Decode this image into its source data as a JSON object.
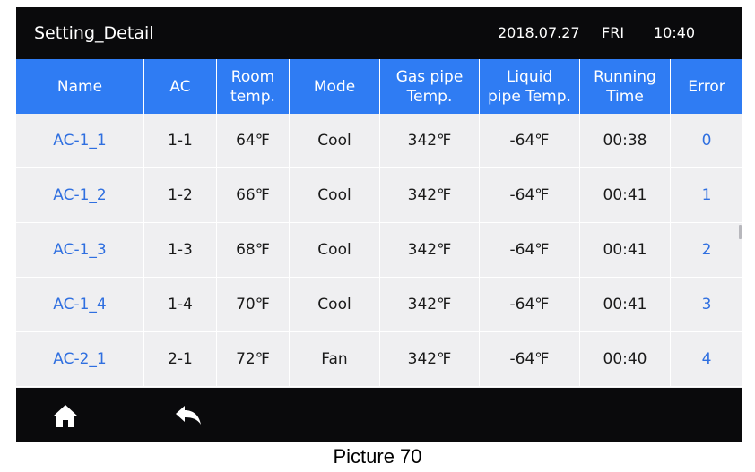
{
  "titlebar": {
    "title": "Setting_Detail",
    "date": "2018.07.27",
    "weekday": "FRI",
    "time": "10:40"
  },
  "table": {
    "headers": [
      "Name",
      "AC",
      "Room\ntemp.",
      "Mode",
      "Gas pipe\nTemp.",
      "Liquid\npipe Temp.",
      "Running\nTime",
      "Error"
    ],
    "rows": [
      [
        "AC-1_1",
        "1-1",
        "64℉",
        "Cool",
        "342℉",
        "-64℉",
        "00:38",
        "0"
      ],
      [
        "AC-1_2",
        "1-2",
        "66℉",
        "Cool",
        "342℉",
        "-64℉",
        "00:41",
        "1"
      ],
      [
        "AC-1_3",
        "1-3",
        "68℉",
        "Cool",
        "342℉",
        "-64℉",
        "00:41",
        "2"
      ],
      [
        "AC-1_4",
        "1-4",
        "70℉",
        "Cool",
        "342℉",
        "-64℉",
        "00:41",
        "3"
      ],
      [
        "AC-2_1",
        "2-1",
        "72℉",
        "Fan",
        "342℉",
        "-64℉",
        "00:40",
        "4"
      ]
    ]
  },
  "bottombar": {
    "home_icon": "home-icon",
    "back_icon": "back-arrow-icon"
  },
  "caption": "Picture 70",
  "colors": {
    "header_blue": "#2f7cf3",
    "row_bg": "#efeff1",
    "link_blue": "#2f6fe0",
    "bar_black": "#0a0a0c"
  }
}
